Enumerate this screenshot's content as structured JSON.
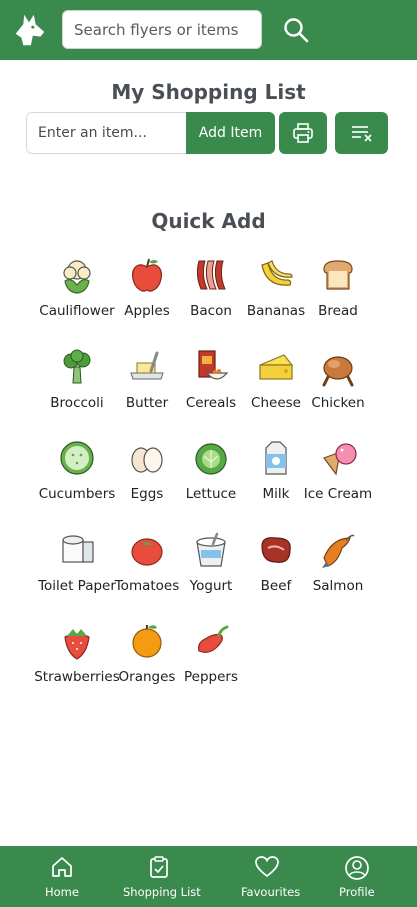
{
  "header": {
    "search_placeholder": "Search flyers or items",
    "brand_color": "#3a8a4e"
  },
  "shopping_list": {
    "title": "My Shopping List",
    "item_placeholder": "Enter an item...",
    "add_button": "Add Item",
    "print_icon": "printer-icon",
    "clear_icon": "clear-list-icon"
  },
  "quick_add": {
    "title": "Quick Add",
    "items": [
      {
        "label": "Cauliflower",
        "icon": "cauliflower"
      },
      {
        "label": "Apples",
        "icon": "apple"
      },
      {
        "label": "Bacon",
        "icon": "bacon"
      },
      {
        "label": "Bananas",
        "icon": "banana"
      },
      {
        "label": "Bread",
        "icon": "bread"
      },
      {
        "label": "Broccoli",
        "icon": "broccoli"
      },
      {
        "label": "Butter",
        "icon": "butter"
      },
      {
        "label": "Cereals",
        "icon": "cereal"
      },
      {
        "label": "Cheese",
        "icon": "cheese"
      },
      {
        "label": "Chicken",
        "icon": "chicken"
      },
      {
        "label": "Cucumbers",
        "icon": "cucumber"
      },
      {
        "label": "Eggs",
        "icon": "eggs"
      },
      {
        "label": "Lettuce",
        "icon": "lettuce"
      },
      {
        "label": "Milk",
        "icon": "milk"
      },
      {
        "label": "Ice Cream",
        "icon": "ice-cream"
      },
      {
        "label": "Toilet Paper",
        "icon": "toilet-paper"
      },
      {
        "label": "Tomatoes",
        "icon": "tomato"
      },
      {
        "label": "Yogurt",
        "icon": "yogurt"
      },
      {
        "label": "Beef",
        "icon": "beef"
      },
      {
        "label": "Salmon",
        "icon": "salmon"
      },
      {
        "label": "Strawberries",
        "icon": "strawberry"
      },
      {
        "label": "Oranges",
        "icon": "orange"
      },
      {
        "label": "Peppers",
        "icon": "pepper"
      }
    ]
  },
  "bottom_nav": {
    "items": [
      {
        "label": "Home",
        "icon": "home-icon"
      },
      {
        "label": "Shopping List",
        "icon": "clipboard-check-icon"
      },
      {
        "label": "Favourites",
        "icon": "heart-icon"
      },
      {
        "label": "Profile",
        "icon": "user-icon"
      }
    ]
  }
}
